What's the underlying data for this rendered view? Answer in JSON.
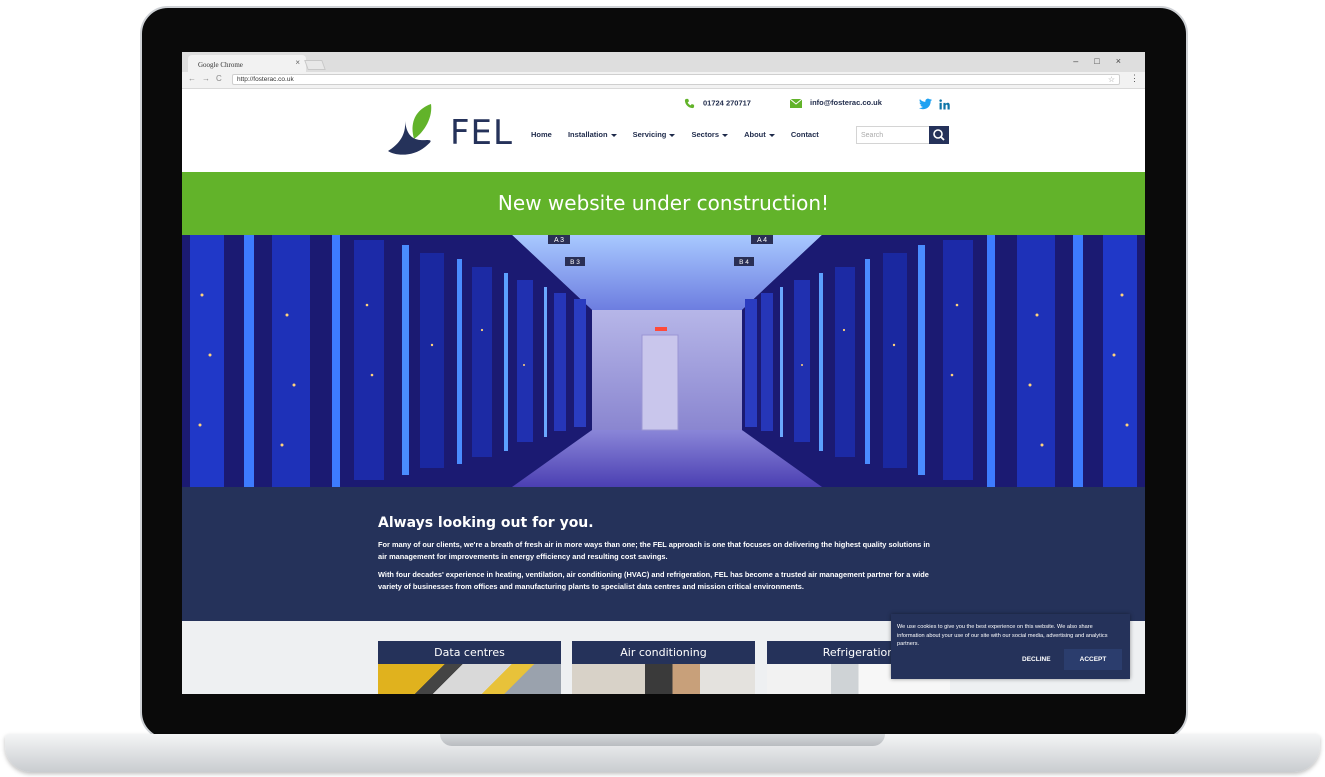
{
  "browser": {
    "tab_title": "Google Chrome",
    "tab_close": "×",
    "window_controls": "–□×",
    "nav_buttons": "←→C",
    "url": "http://fosterac.co.uk",
    "bookmark_star": "☆",
    "menu": "⋮"
  },
  "site": {
    "logo_text": "FEL",
    "phone": "01724 270717",
    "email": "info@fosterac.co.uk",
    "nav": {
      "home": "Home",
      "installation": "Installation",
      "servicing": "Servicing",
      "sectors": "Sectors",
      "about": "About",
      "contact": "Contact"
    },
    "search_placeholder": "Search",
    "banner": "New website under construction!",
    "hero_labels": {
      "a3": "A 3",
      "a4": "A 4",
      "b3": "B 3",
      "b4": "B 4"
    },
    "about": {
      "heading": "Always looking out for you.",
      "p1": "For many of our clients, we're a breath of fresh air in more ways than one; the FEL approach is one that focuses on delivering the highest quality solutions in air management for improvements in energy efficiency and resulting cost savings.",
      "p2": "With four decades' experience in heating, ventilation, air conditioning (HVAC) and refrigeration, FEL has become a trusted air management partner for a wide variety of businesses from offices and manufacturing plants to specialist data centres and mission critical environments."
    },
    "cards": [
      "Data centres",
      "Air conditioning",
      "Refrigeration"
    ],
    "cookie": {
      "text": "We use cookies to give you the best experience on this website. We also share information about your use of our site with our social media, advertising and analytics partners.",
      "decline": "DECLINE",
      "accept": "ACCEPT"
    }
  },
  "colors": {
    "navy": "#25325a",
    "green": "#62b32a",
    "twitter": "#1da1f2",
    "linkedin": "#0e76a8"
  }
}
